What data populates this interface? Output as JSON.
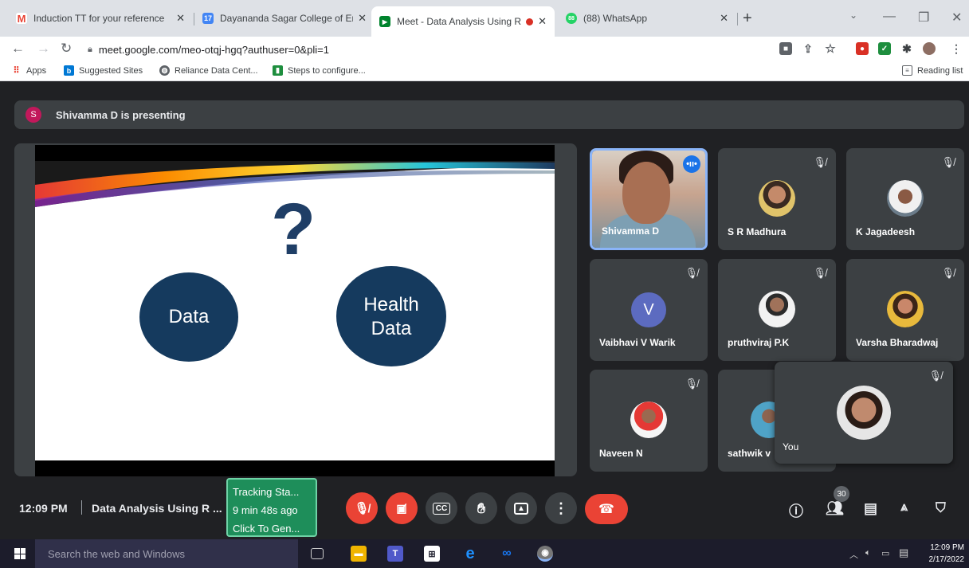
{
  "browser": {
    "tabs": [
      {
        "title": "Induction TT for your reference",
        "icon": "gmail-icon",
        "color": "#ea4335",
        "glyph": "M"
      },
      {
        "title": "Dayananda Sagar College of Eng",
        "icon": "calendar-icon",
        "color": "#4285f4",
        "glyph": "17"
      },
      {
        "title": "Meet - Data Analysis Using R",
        "icon": "meet-icon",
        "color": "#00832d",
        "glyph": "▶"
      },
      {
        "title": "(88) WhatsApp",
        "icon": "whatsapp-icon",
        "color": "#25d366",
        "glyph": "88"
      }
    ],
    "url": "meet.google.com/meo-otqj-hgq?authuser=0&pli=1",
    "bookmarks": [
      {
        "label": "Apps",
        "icon": "apps-grid-icon"
      },
      {
        "label": "Suggested Sites",
        "icon": "bing-icon"
      },
      {
        "label": "Reliance Data Cent...",
        "icon": "globe-icon"
      },
      {
        "label": "Steps to configure...",
        "icon": "bookmark-page-icon"
      }
    ],
    "reading_list": "Reading list"
  },
  "meet": {
    "presenter_initial": "S",
    "presenting_text": "Shivamma D is presenting",
    "slide": {
      "symbol": "?",
      "circle_left": "Data",
      "circle_right_line1": "Health",
      "circle_right_line2": "Data",
      "navy": "#153a5e"
    },
    "participants": [
      {
        "name": "Shivamma D",
        "speaking": true
      },
      {
        "name": "S R Madhura"
      },
      {
        "name": "K Jagadeesh"
      },
      {
        "name": "Vaibhavi V Warik",
        "initial": "V"
      },
      {
        "name": "pruthviraj P.K"
      },
      {
        "name": "Varsha Bharadwaj"
      },
      {
        "name": "Naveen N"
      },
      {
        "name": "sathwik v"
      }
    ],
    "self_label": "You",
    "accent": "#8ab4f8"
  },
  "controls": {
    "time": "12:09 PM",
    "separator": "|",
    "meeting_name": "Data Analysis Using R ...",
    "extension": {
      "line1": "Tracking Sta...",
      "line2": "9 min 48s ago",
      "line3": "Click To Gen..."
    },
    "cc_label": "CC",
    "people_count": "30",
    "danger": "#ea4335"
  },
  "taskbar": {
    "search_placeholder": "Search the web and Windows",
    "time": "12:09 PM",
    "date": "2/17/2022"
  }
}
